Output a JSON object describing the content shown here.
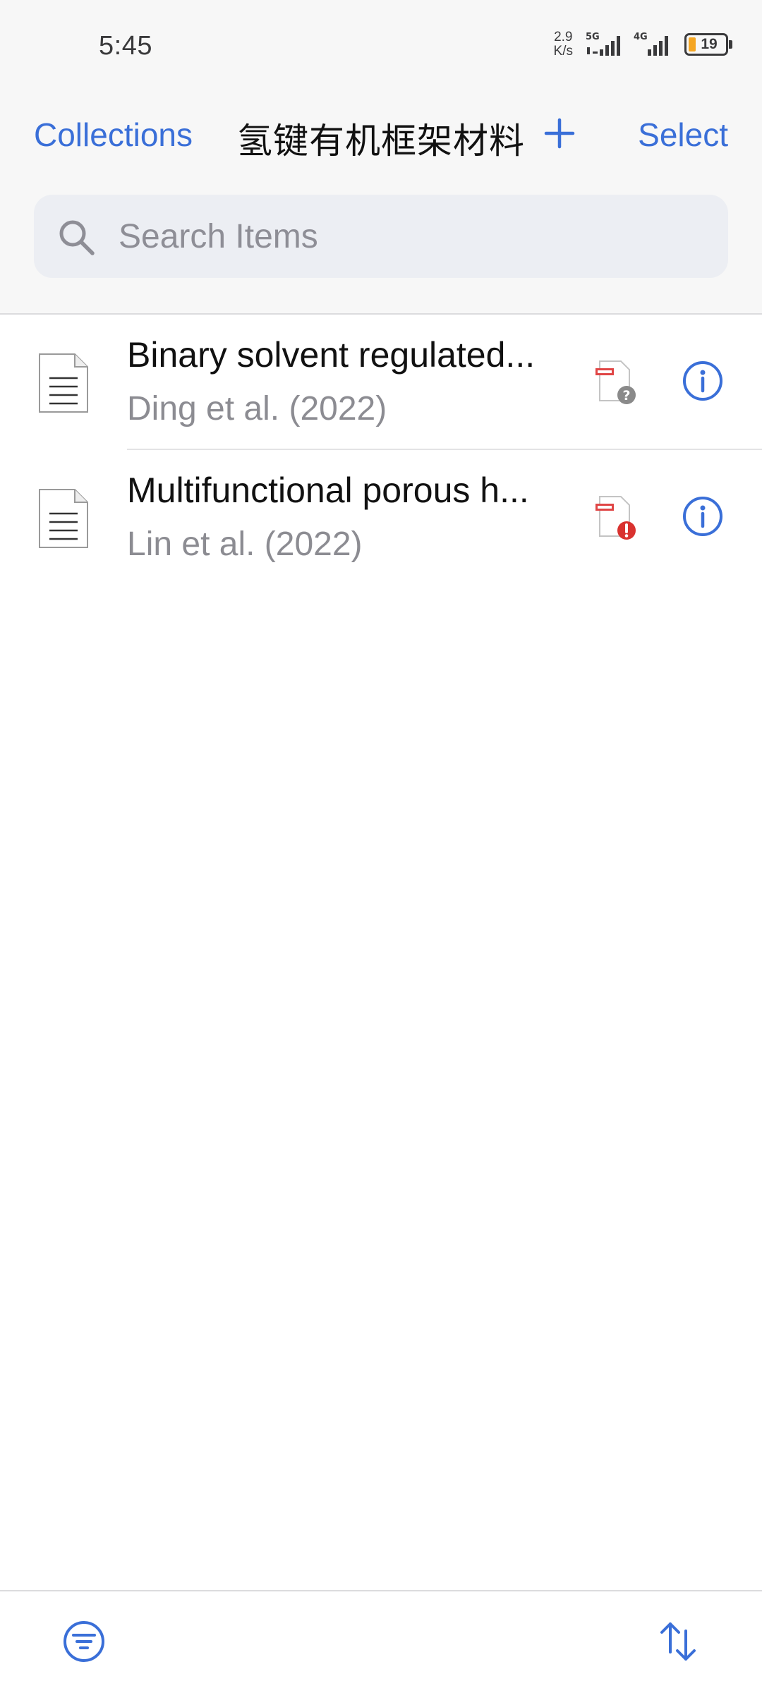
{
  "status_bar": {
    "time": "5:45",
    "net_speed_value": "2.9",
    "net_speed_unit": "K/s",
    "signal_1_label": "5G",
    "signal_2_label": "4G",
    "battery_level": "19"
  },
  "nav": {
    "back_label": "Collections",
    "title": "氢键有机框架材料",
    "add_icon": "plus-icon",
    "select_label": "Select"
  },
  "search": {
    "placeholder": "Search Items",
    "value": ""
  },
  "items": [
    {
      "title": "Binary solvent regulated...",
      "subtitle": "Ding et al. (2022)",
      "item_icon": "document-icon",
      "attachment_status": "pdf-missing-question-icon",
      "info_icon": "info-icon"
    },
    {
      "title": "Multifunctional porous h...",
      "subtitle": "Lin et al. (2022)",
      "item_icon": "document-icon",
      "attachment_status": "pdf-error-icon",
      "info_icon": "info-icon"
    }
  ],
  "toolbar": {
    "filter_icon": "filter-icon",
    "sort_icon": "sort-icon"
  },
  "colors": {
    "accent": "#3a6fd8",
    "error": "#d9322f",
    "pdf_red": "#e04545",
    "battery": "#f5a623"
  }
}
